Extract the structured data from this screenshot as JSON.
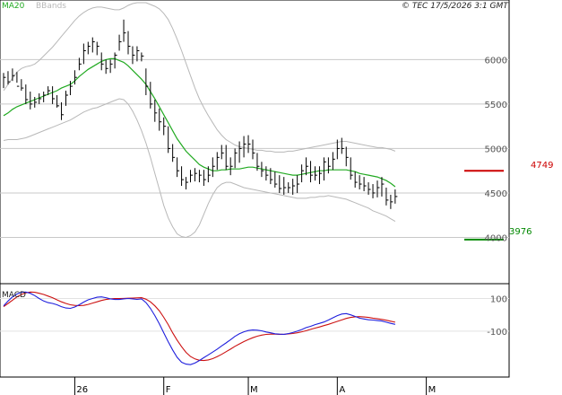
{
  "header": {
    "ma_label": "MA20",
    "bbands_label": "BBands",
    "copyright": "© TEC 17/5/2026 3:1 GMT"
  },
  "levels": {
    "resistance": "4749",
    "support": "3976"
  },
  "macd_panel": {
    "label": "MACD"
  },
  "colors": {
    "ma20": "#22aa22",
    "bbands": "#b8b8b8",
    "price_bars": "#000000",
    "resistance": "#cc0000",
    "support": "#008800",
    "macd_line": "#1f1fdd",
    "signal_line": "#cc1111",
    "grid": "#c8c8c8",
    "axis_text": "#555555"
  },
  "chart_data": [
    {
      "type": "line",
      "title": "",
      "yaxis_ticks": [
        6000,
        5500,
        5000,
        4500,
        4000
      ],
      "tick_labels": [
        "6000",
        "5500",
        "5000",
        "4500",
        "4000"
      ],
      "ylim": [
        3500,
        6650
      ],
      "xlim": [
        0,
        112
      ],
      "x_labels": [
        {
          "label": "26",
          "x": 16
        },
        {
          "label": "F",
          "x": 36
        },
        {
          "label": "M",
          "x": 55
        },
        {
          "label": "A",
          "x": 75
        },
        {
          "label": "M",
          "x": 95
        }
      ],
      "horizontal_levels": [
        {
          "name": "resistance",
          "value": 4749,
          "color": "#cc0000"
        },
        {
          "name": "support",
          "value": 3976,
          "color": "#008800"
        }
      ],
      "series": [
        {
          "kind": "ohlc",
          "points": [
            [
              5680,
              5850,
              5800
            ],
            [
              5720,
              5870,
              5750
            ],
            [
              5760,
              5900,
              5820
            ],
            [
              5740,
              5860,
              5700
            ],
            [
              5650,
              5780,
              5680
            ],
            [
              5500,
              5720,
              5550
            ],
            [
              5440,
              5640,
              5500
            ],
            [
              5460,
              5580,
              5520
            ],
            [
              5500,
              5620,
              5560
            ],
            [
              5520,
              5640,
              5600
            ],
            [
              5600,
              5700,
              5650
            ],
            [
              5500,
              5700,
              5560
            ],
            [
              5460,
              5600,
              5480
            ],
            [
              5320,
              5520,
              5380
            ],
            [
              5480,
              5650,
              5600
            ],
            [
              5600,
              5760,
              5700
            ],
            [
              5720,
              5880,
              5800
            ],
            [
              5880,
              6020,
              5950
            ],
            [
              5950,
              6180,
              6100
            ],
            [
              6060,
              6200,
              6150
            ],
            [
              6080,
              6250,
              6200
            ],
            [
              6050,
              6200,
              6150
            ],
            [
              5880,
              6080,
              5950
            ],
            [
              5840,
              6000,
              5900
            ],
            [
              5850,
              6000,
              5950
            ],
            [
              5900,
              6080,
              6050
            ],
            [
              6100,
              6280,
              6200
            ],
            [
              6200,
              6450,
              6300
            ],
            [
              6060,
              6320,
              6150
            ],
            [
              5950,
              6150,
              6050
            ],
            [
              5980,
              6150,
              6100
            ],
            [
              5980,
              6080,
              6040
            ],
            [
              5600,
              5900,
              5700
            ],
            [
              5450,
              5750,
              5500
            ],
            [
              5300,
              5550,
              5400
            ],
            [
              5200,
              5450,
              5300
            ],
            [
              5150,
              5350,
              5250
            ],
            [
              4950,
              5250,
              5000
            ],
            [
              4850,
              5050,
              4900
            ],
            [
              4680,
              4900,
              4750
            ],
            [
              4580,
              4800,
              4650
            ],
            [
              4540,
              4680,
              4620
            ],
            [
              4620,
              4760,
              4700
            ],
            [
              4630,
              4780,
              4720
            ],
            [
              4620,
              4760,
              4700
            ],
            [
              4580,
              4760,
              4650
            ],
            [
              4620,
              4800,
              4700
            ],
            [
              4680,
              4900,
              4800
            ],
            [
              4760,
              4960,
              4900
            ],
            [
              4880,
              5040,
              4950
            ],
            [
              4760,
              5040,
              4800
            ],
            [
              4700,
              4900,
              4800
            ],
            [
              4780,
              5000,
              4950
            ],
            [
              4840,
              5080,
              5000
            ],
            [
              4900,
              5140,
              5050
            ],
            [
              4950,
              5150,
              5050
            ],
            [
              4880,
              5100,
              4950
            ],
            [
              4750,
              4950,
              4800
            ],
            [
              4680,
              4850,
              4750
            ],
            [
              4640,
              4800,
              4700
            ],
            [
              4600,
              4780,
              4650
            ],
            [
              4560,
              4740,
              4600
            ],
            [
              4500,
              4700,
              4550
            ],
            [
              4480,
              4680,
              4560
            ],
            [
              4500,
              4620,
              4560
            ],
            [
              4480,
              4660,
              4580
            ],
            [
              4500,
              4700,
              4600
            ],
            [
              4620,
              4820,
              4750
            ],
            [
              4700,
              4900,
              4800
            ],
            [
              4620,
              4860,
              4700
            ],
            [
              4640,
              4800,
              4700
            ],
            [
              4600,
              4800,
              4720
            ],
            [
              4640,
              4900,
              4850
            ],
            [
              4720,
              4900,
              4800
            ],
            [
              4760,
              4960,
              4880
            ],
            [
              4880,
              5100,
              5000
            ],
            [
              4940,
              5120,
              5000
            ],
            [
              4800,
              5020,
              4900
            ],
            [
              4650,
              4900,
              4700
            ],
            [
              4560,
              4740,
              4620
            ],
            [
              4540,
              4700,
              4600
            ],
            [
              4520,
              4680,
              4580
            ],
            [
              4480,
              4620,
              4540
            ],
            [
              4440,
              4600,
              4500
            ],
            [
              4450,
              4640,
              4560
            ],
            [
              4460,
              4680,
              4600
            ],
            [
              4360,
              4560,
              4420
            ],
            [
              4320,
              4480,
              4400
            ],
            [
              4380,
              4540,
              4460
            ]
          ]
        },
        {
          "name": "MA20",
          "values": [
            5370,
            5400,
            5440,
            5470,
            5490,
            5510,
            5530,
            5550,
            5570,
            5590,
            5610,
            5630,
            5650,
            5680,
            5700,
            5720,
            5760,
            5810,
            5850,
            5890,
            5920,
            5950,
            5980,
            6000,
            6010,
            6010,
            5990,
            5970,
            5930,
            5880,
            5830,
            5780,
            5720,
            5640,
            5560,
            5470,
            5380,
            5290,
            5200,
            5110,
            5040,
            4970,
            4920,
            4870,
            4820,
            4790,
            4770,
            4750,
            4750,
            4760,
            4760,
            4770,
            4770,
            4770,
            4780,
            4790,
            4790,
            4780,
            4770,
            4760,
            4750,
            4740,
            4730,
            4720,
            4710,
            4700,
            4700,
            4710,
            4720,
            4730,
            4740,
            4750,
            4750,
            4760,
            4760,
            4760,
            4760,
            4760,
            4750,
            4740,
            4720,
            4710,
            4700,
            4690,
            4680,
            4660,
            4640,
            4610,
            4570
          ]
        },
        {
          "name": "BBands upper",
          "values": [
            5650,
            5720,
            5790,
            5860,
            5900,
            5920,
            5930,
            5950,
            5990,
            6040,
            6090,
            6140,
            6200,
            6260,
            6320,
            6380,
            6440,
            6490,
            6530,
            6560,
            6580,
            6590,
            6590,
            6580,
            6570,
            6560,
            6560,
            6580,
            6610,
            6630,
            6640,
            6640,
            6640,
            6620,
            6600,
            6570,
            6520,
            6450,
            6350,
            6230,
            6100,
            5960,
            5820,
            5680,
            5560,
            5460,
            5370,
            5290,
            5210,
            5150,
            5100,
            5070,
            5040,
            5020,
            5010,
            5000,
            4990,
            4980,
            4980,
            4970,
            4970,
            4960,
            4960,
            4960,
            4970,
            4970,
            4980,
            4990,
            5000,
            5010,
            5020,
            5030,
            5040,
            5050,
            5060,
            5070,
            5080,
            5080,
            5070,
            5060,
            5050,
            5040,
            5030,
            5020,
            5010,
            5010,
            5000,
            4990,
            4970
          ]
        },
        {
          "name": "BBands lower",
          "values": [
            5090,
            5100,
            5100,
            5100,
            5110,
            5120,
            5140,
            5160,
            5180,
            5200,
            5220,
            5240,
            5260,
            5280,
            5300,
            5320,
            5350,
            5380,
            5410,
            5430,
            5450,
            5460,
            5480,
            5500,
            5520,
            5540,
            5560,
            5550,
            5500,
            5420,
            5320,
            5200,
            5060,
            4900,
            4720,
            4540,
            4360,
            4220,
            4120,
            4040,
            4010,
            4000,
            4020,
            4060,
            4140,
            4260,
            4380,
            4480,
            4560,
            4600,
            4620,
            4620,
            4600,
            4580,
            4560,
            4550,
            4540,
            4530,
            4520,
            4510,
            4500,
            4490,
            4480,
            4470,
            4460,
            4450,
            4440,
            4440,
            4440,
            4450,
            4450,
            4460,
            4460,
            4470,
            4460,
            4450,
            4440,
            4430,
            4410,
            4390,
            4370,
            4350,
            4330,
            4300,
            4280,
            4260,
            4240,
            4210,
            4180
          ]
        }
      ]
    },
    {
      "type": "line",
      "title": "",
      "yaxis_ticks": [
        100,
        -100
      ],
      "tick_labels": [
        "100",
        "-100"
      ],
      "ylim": [
        -370,
        180
      ],
      "xlim": [
        0,
        112
      ],
      "series": [
        {
          "name": "MACD",
          "values": [
            55,
            85,
            110,
            128,
            138,
            140,
            132,
            118,
            100,
            85,
            75,
            70,
            62,
            50,
            42,
            40,
            48,
            62,
            78,
            92,
            100,
            108,
            110,
            105,
            98,
            94,
            94,
            98,
            100,
            98,
            95,
            98,
            75,
            40,
            -5,
            -55,
            -110,
            -165,
            -215,
            -260,
            -290,
            -302,
            -305,
            -295,
            -280,
            -262,
            -245,
            -228,
            -210,
            -190,
            -172,
            -152,
            -132,
            -116,
            -104,
            -96,
            -93,
            -94,
            -98,
            -105,
            -110,
            -116,
            -118,
            -119,
            -115,
            -108,
            -100,
            -90,
            -78,
            -70,
            -60,
            -52,
            -44,
            -32,
            -18,
            -5,
            5,
            8,
            0,
            -10,
            -20,
            -25,
            -30,
            -32,
            -35,
            -38,
            -45,
            -52,
            -58
          ]
        },
        {
          "name": "Signal",
          "values": [
            50,
            70,
            90,
            110,
            125,
            135,
            140,
            138,
            132,
            125,
            115,
            105,
            92,
            80,
            70,
            62,
            58,
            56,
            58,
            64,
            72,
            80,
            88,
            94,
            98,
            100,
            100,
            101,
            102,
            103,
            104,
            105,
            96,
            80,
            55,
            25,
            -15,
            -60,
            -110,
            -155,
            -195,
            -230,
            -255,
            -270,
            -278,
            -280,
            -276,
            -268,
            -256,
            -242,
            -226,
            -210,
            -193,
            -178,
            -164,
            -151,
            -140,
            -131,
            -124,
            -120,
            -118,
            -118,
            -119,
            -119,
            -117,
            -114,
            -110,
            -104,
            -97,
            -89,
            -81,
            -74,
            -66,
            -58,
            -49,
            -40,
            -31,
            -22,
            -16,
            -12,
            -11,
            -13,
            -16,
            -20,
            -24,
            -28,
            -33,
            -39,
            -45
          ]
        }
      ]
    }
  ]
}
